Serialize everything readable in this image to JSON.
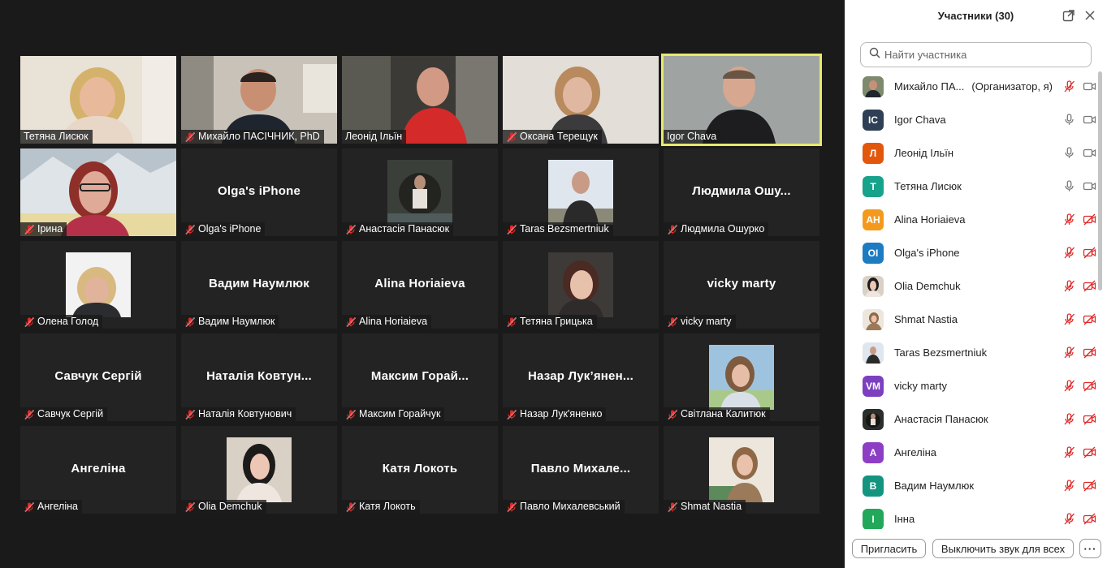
{
  "sidebar": {
    "title": "Участники (30)",
    "search_placeholder": "Найти участника",
    "participants": [
      {
        "name": "Михайло ПА...",
        "role": "(Организатор, я)",
        "avatar": "photo",
        "mic": "muted",
        "cam": "on"
      },
      {
        "name": "Igor Chava",
        "initials": "IC",
        "color": "#2f3f55",
        "mic": "on",
        "cam": "on"
      },
      {
        "name": "Леонід Ільїн",
        "initials": "Л",
        "color": "#e2570c",
        "mic": "on",
        "cam": "on"
      },
      {
        "name": "Тетяна Лисюк",
        "initials": "Т",
        "color": "#17a28b",
        "mic": "on",
        "cam": "on"
      },
      {
        "name": "Alina Horiaieva",
        "initials": "AH",
        "color": "#f39a1e",
        "mic": "muted",
        "cam": "off"
      },
      {
        "name": "Olga's iPhone",
        "initials": "OI",
        "color": "#1d7bc2",
        "mic": "muted",
        "cam": "off"
      },
      {
        "name": "Olia Demchuk",
        "avatar": "photo",
        "mic": "muted",
        "cam": "off"
      },
      {
        "name": "Shmat Nastia",
        "avatar": "photo",
        "mic": "muted",
        "cam": "off"
      },
      {
        "name": "Taras Bezsmertniuk",
        "avatar": "photo",
        "mic": "muted",
        "cam": "off"
      },
      {
        "name": "vicky marty",
        "initials": "VM",
        "color": "#7c3fc0",
        "mic": "muted",
        "cam": "off"
      },
      {
        "name": "Анастасія Панасюк",
        "avatar": "photo",
        "mic": "muted",
        "cam": "off"
      },
      {
        "name": "Ангеліна",
        "initials": "А",
        "color": "#8c3fc4",
        "mic": "muted",
        "cam": "off"
      },
      {
        "name": "Вадим Наумлюк",
        "initials": "В",
        "color": "#13947f",
        "mic": "muted",
        "cam": "off"
      },
      {
        "name": "Інна",
        "initials": "І",
        "color": "#22a85a",
        "mic": "muted",
        "cam": "off"
      }
    ],
    "invite_label": "Пригласить",
    "mute_all_label": "Выключить звук для всех",
    "more_label": "···"
  },
  "gallery": {
    "tiles": [
      {
        "name": "Тетяна Лисюк",
        "muted": false,
        "video": "Тетяна Лисюк"
      },
      {
        "name": "Михайло ПАСІЧНИК, PhD",
        "muted": true,
        "video": "Михайло ПАСІЧНИК, PhD"
      },
      {
        "name": "Леонід Ільїн",
        "muted": false,
        "video": "Леонід Ільїн"
      },
      {
        "name": "Оксана Терещук",
        "muted": true,
        "video": "Оксана Терещук"
      },
      {
        "name": "Igor Chava",
        "muted": false,
        "video": "Igor Chava",
        "active": true
      },
      {
        "name": "Ірина",
        "muted": true,
        "video": "Ірина"
      },
      {
        "name": "Olga's iPhone",
        "muted": true,
        "big": "Olga's iPhone"
      },
      {
        "name": "Анастасія Панасюк",
        "muted": true,
        "thumb": "Анастасія Панасюк"
      },
      {
        "name": "Taras Bezsmertniuk",
        "muted": true,
        "thumb": "Taras Bezsmertniuk"
      },
      {
        "name": "Людмила Ошурко",
        "muted": true,
        "big": "Людмила  Ошу..."
      },
      {
        "name": "Олена Голод",
        "muted": true,
        "thumb": "Олена Голод"
      },
      {
        "name": "Вадим Наумлюк",
        "muted": true,
        "big": "Вадим Наумлюк"
      },
      {
        "name": "Alina Horiaieva",
        "muted": true,
        "big": "Alina Horiaieva"
      },
      {
        "name": "Тетяна Грицька",
        "muted": true,
        "thumb": "Тетяна Грицька"
      },
      {
        "name": "vicky marty",
        "muted": true,
        "big": "vicky marty"
      },
      {
        "name": "Савчук Сергій",
        "muted": true,
        "big": "Савчук Сергій"
      },
      {
        "name": "Наталія Ковтунович",
        "muted": true,
        "big": "Наталія  Ковтун..."
      },
      {
        "name": "Максим Горайчук",
        "muted": true,
        "big": "Максим  Горай..."
      },
      {
        "name": "Назар Лук'яненко",
        "muted": true,
        "big": "Назар  Лук’янен..."
      },
      {
        "name": "Світлана Калитюк",
        "muted": true,
        "thumb": "Світлана Калитюк"
      },
      {
        "name": "Ангеліна",
        "muted": true,
        "big": "Ангеліна"
      },
      {
        "name": "Olia Demchuk",
        "muted": true,
        "thumb": "Olia Demchuk"
      },
      {
        "name": "Катя Локоть",
        "muted": true,
        "big": "Катя Локоть"
      },
      {
        "name": "Павло Михалевський",
        "muted": true,
        "big": "Павло  Михале..."
      },
      {
        "name": "Shmat Nastia",
        "muted": true,
        "thumb": "Shmat Nastia"
      }
    ]
  },
  "colors": {
    "active_speaker": "#e6ea6a",
    "muted_red": "#e02828",
    "tile_bg": "#232323"
  }
}
